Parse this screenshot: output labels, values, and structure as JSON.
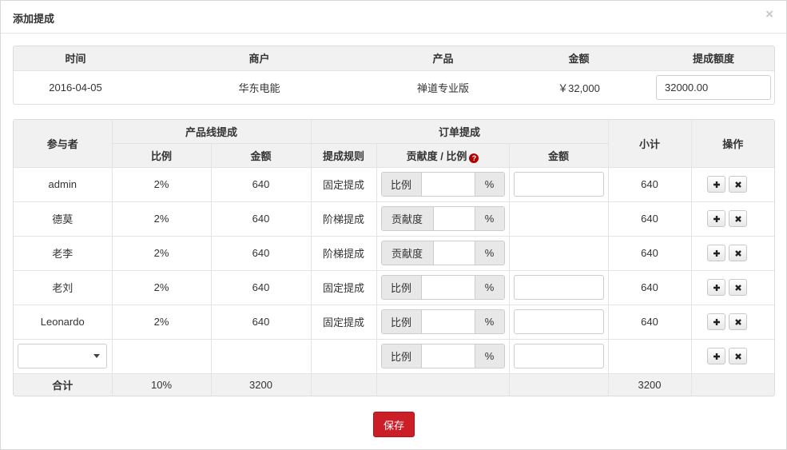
{
  "dialog": {
    "title": "添加提成",
    "close_label": "×",
    "save_label": "保存"
  },
  "summary": {
    "headers": [
      "时间",
      "商户",
      "产品",
      "金额",
      "提成额度"
    ],
    "row": {
      "date": "2016-04-05",
      "merchant": "华东电能",
      "product": "禅道专业版",
      "amount": "￥32,000",
      "bonus_amount": "32000.00"
    }
  },
  "commission_table": {
    "headers": {
      "participant": "参与者",
      "product_line": "产品线提成",
      "order": "订单提成",
      "subtotal": "小计",
      "actions": "操作",
      "ratio": "比例",
      "amount": "金额",
      "rule": "提成规则",
      "contribution_ratio": "贡献度 / 比例",
      "order_amount": "金额"
    },
    "help_icon": "?",
    "percent_suffix": "%",
    "rows": [
      {
        "participant": "admin",
        "ratio": "2%",
        "amount": "640",
        "rule": "固定提成",
        "input_prefix": "比例",
        "has_amount_input": true,
        "subtotal": "640"
      },
      {
        "participant": "德莫",
        "ratio": "2%",
        "amount": "640",
        "rule": "阶梯提成",
        "input_prefix": "贡献度",
        "has_amount_input": false,
        "subtotal": "640"
      },
      {
        "participant": "老李",
        "ratio": "2%",
        "amount": "640",
        "rule": "阶梯提成",
        "input_prefix": "贡献度",
        "has_amount_input": false,
        "subtotal": "640"
      },
      {
        "participant": "老刘",
        "ratio": "2%",
        "amount": "640",
        "rule": "固定提成",
        "input_prefix": "比例",
        "has_amount_input": true,
        "subtotal": "640"
      },
      {
        "participant": "Leonardo",
        "ratio": "2%",
        "amount": "640",
        "rule": "固定提成",
        "input_prefix": "比例",
        "has_amount_input": true,
        "subtotal": "640"
      }
    ],
    "new_row": {
      "participant_selected": "",
      "input_prefix": "比例"
    },
    "total": {
      "label": "合计",
      "ratio": "10%",
      "amount": "3200",
      "subtotal": "3200"
    }
  },
  "icons": {
    "add": "plus-icon",
    "remove": "close-icon",
    "dropdown": "chevron-down-icon",
    "help": "help-icon"
  },
  "colors": {
    "primary_button": "#cc1e27",
    "help_icon": "#b00000",
    "header_bg": "#f1f1f1"
  }
}
